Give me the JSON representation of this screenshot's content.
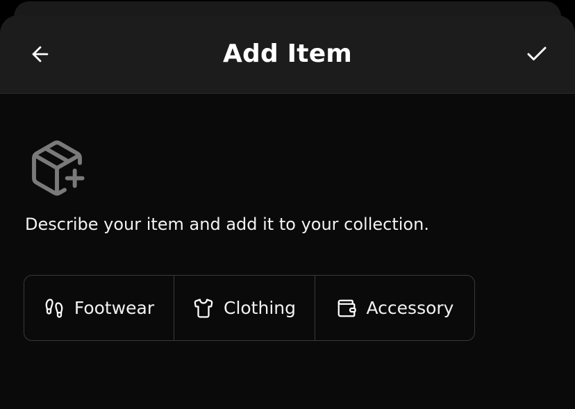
{
  "header": {
    "title": "Add Item",
    "back_icon": "arrow-left-icon",
    "confirm_icon": "check-icon"
  },
  "body": {
    "hero_icon": "package-plus-icon",
    "description": "Describe your item and add it to your collection."
  },
  "category_selector": {
    "options": [
      {
        "label": "Footwear",
        "icon": "footprints-icon"
      },
      {
        "label": "Clothing",
        "icon": "shirt-icon"
      },
      {
        "label": "Accessory",
        "icon": "wallet-icon"
      }
    ]
  },
  "colors": {
    "background": "#000000",
    "sheet": "#0a0a0a",
    "header": "#1c1c1c",
    "border": "#3a3a3a",
    "text": "#ffffff",
    "muted_icon": "#7a7a7a"
  }
}
